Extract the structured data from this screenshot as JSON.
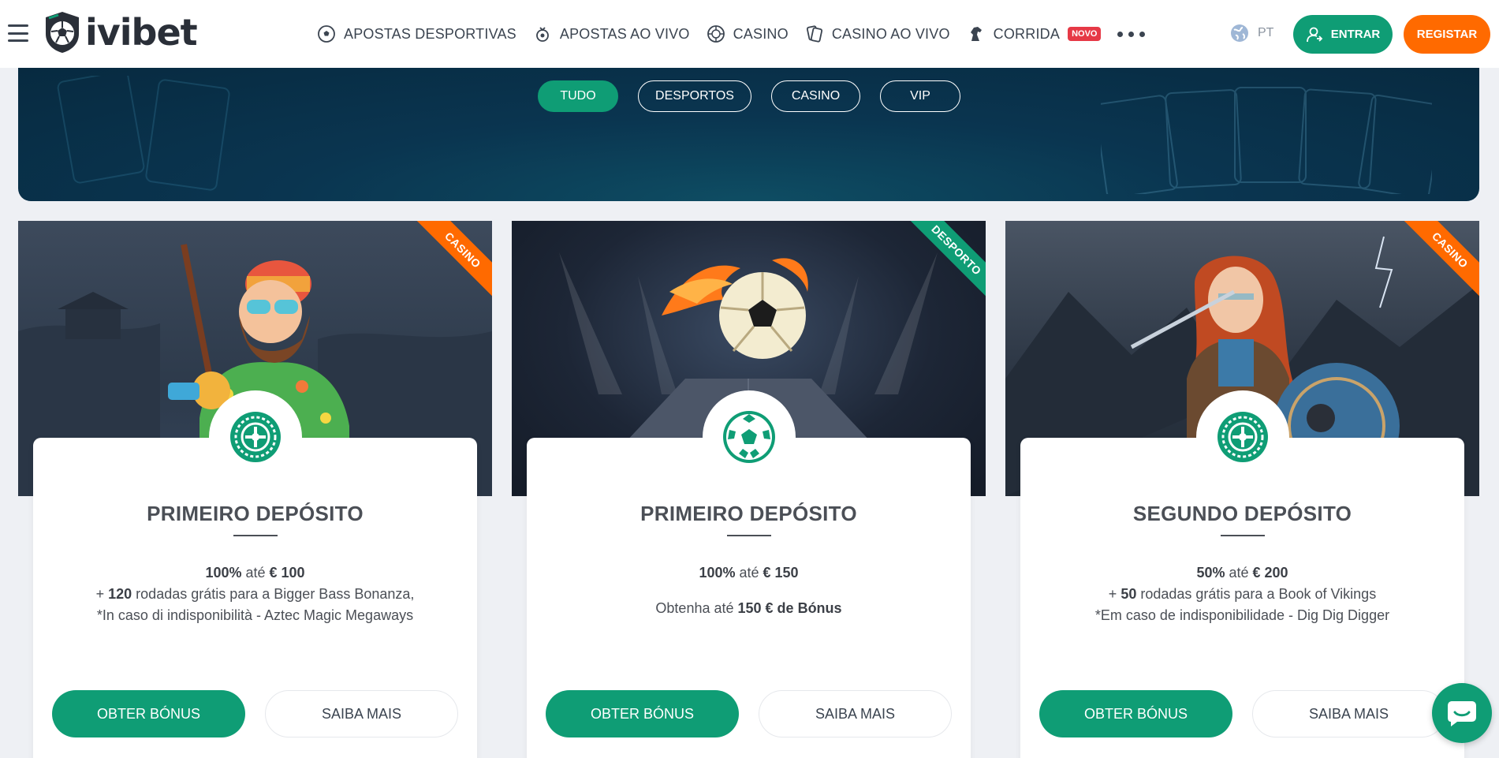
{
  "header": {
    "logo_text": "ivibet",
    "nav": [
      {
        "label": "APOSTAS DESPORTIVAS",
        "icon": "soccer-ball-icon"
      },
      {
        "label": "APOSTAS AO VIVO",
        "icon": "live-ball-icon"
      },
      {
        "label": "CASINO",
        "icon": "roulette-icon"
      },
      {
        "label": "CASINO AO VIVO",
        "icon": "cards-icon"
      },
      {
        "label": "CORRIDA",
        "icon": "horse-icon",
        "badge": "NOVO"
      }
    ],
    "language": "PT",
    "login_label": "ENTRAR",
    "register_label": "REGISTAR"
  },
  "filters": [
    {
      "label": "TUDO",
      "active": true
    },
    {
      "label": "DESPORTOS",
      "active": false
    },
    {
      "label": "CASINO",
      "active": false
    },
    {
      "label": "VIP",
      "active": false
    }
  ],
  "cards": [
    {
      "ribbon": "CASINO",
      "ribbon_color": "#ff6a00",
      "title": "PRIMEIRO DEPÓSITO",
      "line1_a": "100%",
      "line1_b": " até ",
      "line1_c": "€ 100",
      "line2_a": "+ ",
      "line2_b": "120",
      "line2_c": " rodadas grátis para a Bigger Bass Bonanza,",
      "line3": "*In caso di indisponibilità - Aztec Magic Megaways",
      "btn_primary": "OBTER BÓNUS",
      "btn_secondary": "SAIBA MAIS"
    },
    {
      "ribbon": "DESPORTO",
      "ribbon_color": "#0f9d75",
      "title": "PRIMEIRO DEPÓSITO",
      "line1_a": "100%",
      "line1_b": " até ",
      "line1_c": "€ 150",
      "line2_a": "Obtenha até ",
      "line2_b": "150 € de Bónus",
      "btn_primary": "OBTER BÓNUS",
      "btn_secondary": "SAIBA MAIS"
    },
    {
      "ribbon": "CASINO",
      "ribbon_color": "#ff6a00",
      "title": "SEGUNDO DEPÓSITO",
      "line1_a": "50%",
      "line1_b": " até ",
      "line1_c": "€ 200",
      "line2_a": "+ ",
      "line2_b": "50",
      "line2_c": " rodadas grátis para a Book of Vikings",
      "line3": "*Em caso de indisponibilidade -  Dig Dig Digger",
      "btn_primary": "OBTER BÓNUS",
      "btn_secondary": "SAIBA MAIS"
    }
  ],
  "colors": {
    "primary": "#0f9d75",
    "accent": "#ff6a00",
    "hero_dark": "#072a40"
  }
}
